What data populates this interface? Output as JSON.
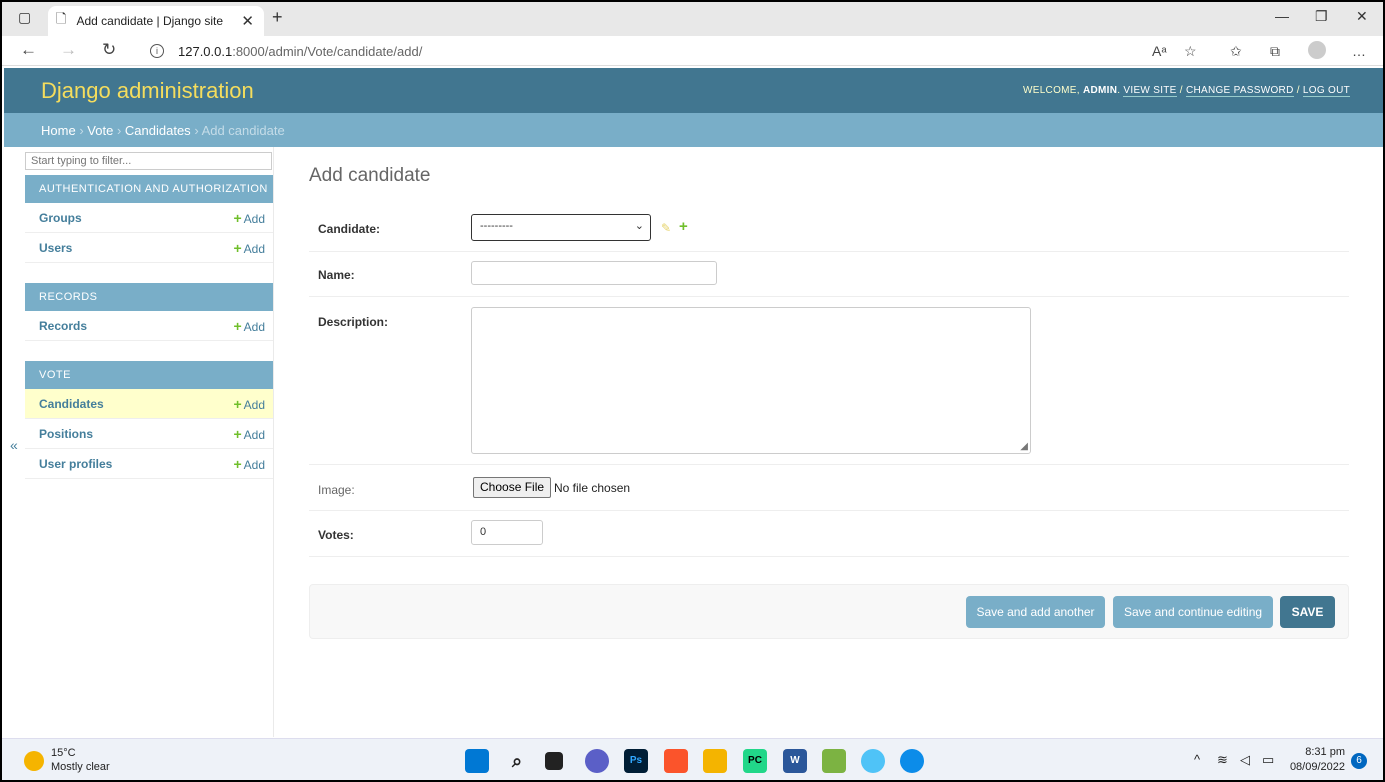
{
  "browser": {
    "tab_title": "Add candidate | Django site adm",
    "url_host": "127.0.0.1",
    "url_path": ":8000/admin/Vote/candidate/add/",
    "read_aloud": "Aᵃ"
  },
  "header": {
    "branding": "Django administration",
    "welcome": "WELCOME,",
    "username": "ADMIN",
    "view_site": "VIEW SITE",
    "change_password": "CHANGE PASSWORD",
    "log_out": "LOG OUT",
    "sep": "/"
  },
  "breadcrumbs": {
    "home": "Home",
    "app": "Vote",
    "model": "Candidates",
    "current": "Add candidate",
    "sep": "›"
  },
  "sidebar": {
    "filter_placeholder": "Start typing to filter...",
    "toggle": "«",
    "add_label": "Add",
    "modules": [
      {
        "caption": "AUTHENTICATION AND AUTHORIZATION",
        "items": [
          "Groups",
          "Users"
        ]
      },
      {
        "caption": "RECORDS",
        "items": [
          "Records"
        ]
      },
      {
        "caption": "VOTE",
        "items": [
          "Candidates",
          "Positions",
          "User profiles"
        ]
      }
    ]
  },
  "form": {
    "title": "Add candidate",
    "candidate_label": "Candidate:",
    "candidate_value": "---------",
    "name_label": "Name:",
    "description_label": "Description:",
    "image_label": "Image:",
    "choose_file": "Choose File",
    "no_file": "No file chosen",
    "votes_label": "Votes:",
    "votes_value": "0"
  },
  "buttons": {
    "save_add_another": "Save and add another",
    "save_continue": "Save and continue editing",
    "save": "SAVE"
  },
  "taskbar": {
    "temperature": "15°C",
    "condition": "Mostly clear",
    "time": "8:31 pm",
    "date": "08/09/2022",
    "notifications": "6"
  },
  "colors": {
    "header_bg": "#417690",
    "breadcrumb_bg": "#79aec8",
    "branding": "#f5dd5d",
    "add_green": "#70bf2b",
    "current_row": "#ffffcc"
  }
}
